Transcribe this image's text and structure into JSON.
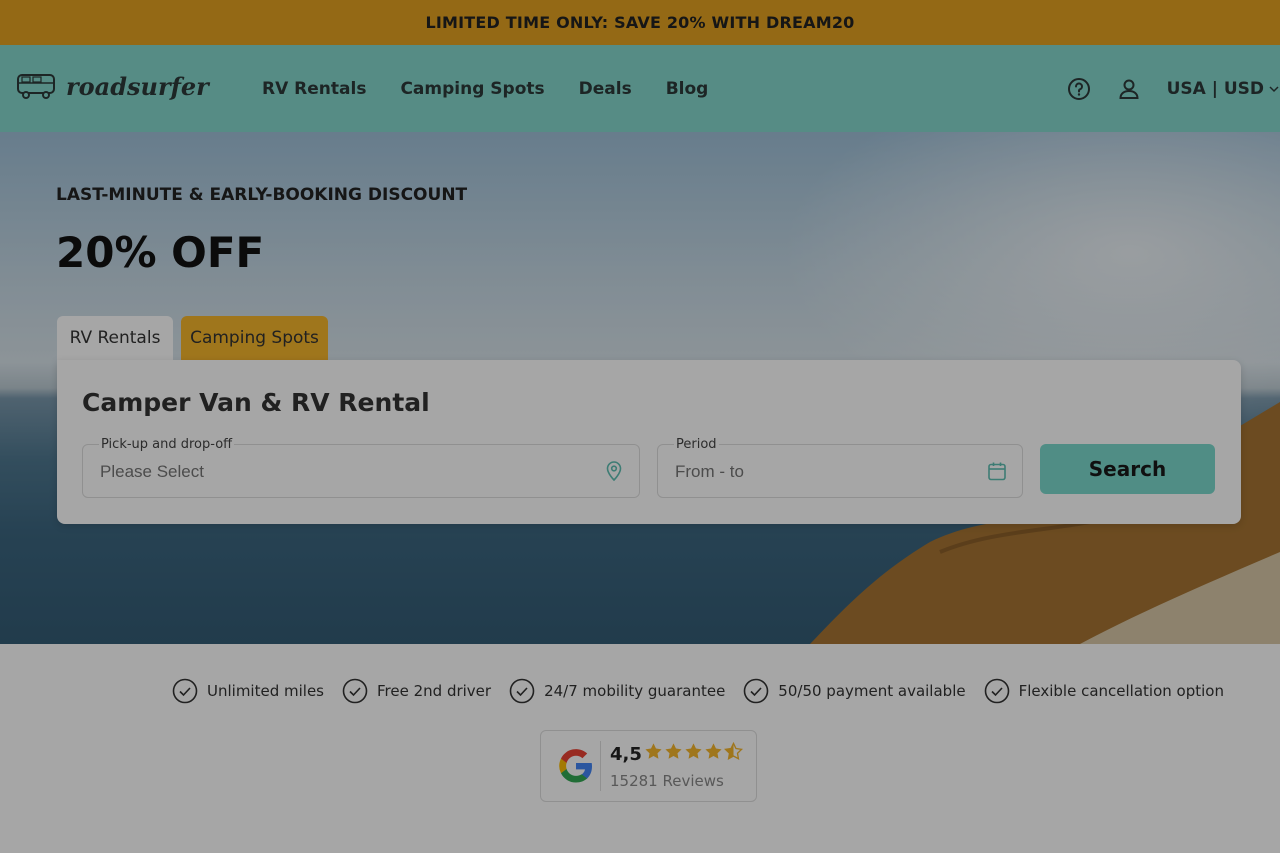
{
  "promo": {
    "text": "LIMITED TIME ONLY: SAVE 20% WITH DREAM20"
  },
  "header": {
    "logo_text": "roadsurfer",
    "nav": [
      "RV Rentals",
      "Camping Spots",
      "Deals",
      "Blog"
    ],
    "locale": "USA | USD",
    "icons": [
      "help-icon",
      "user-icon",
      "chevron-down-icon"
    ]
  },
  "hero": {
    "kicker": "LAST-MINUTE & EARLY-BOOKING DISCOUNT",
    "headline": "20% OFF",
    "tabs": [
      "RV Rentals",
      "Camping Spots"
    ],
    "active_tab": "RV Rentals"
  },
  "search": {
    "title": "Camper Van & RV Rental",
    "pickup": {
      "label": "Pick-up and drop-off",
      "placeholder": "Please Select",
      "icon": "location-pin-icon"
    },
    "period": {
      "label": "Period",
      "placeholder": "From - to",
      "icon": "calendar-icon"
    },
    "button": "Search"
  },
  "usps": [
    "Unlimited miles",
    "Free 2nd driver",
    "24/7 mobility guarantee",
    "50/50 payment available",
    "Flexible cancellation option"
  ],
  "reviews": {
    "rating": "4,5",
    "stars": 4.5,
    "count": "15281 Reviews",
    "icon": "google-icon"
  },
  "colors": {
    "promo": "#e3a221",
    "nav": "#84d8cc",
    "accent": "#7cd9cd",
    "tab_active": "#f5b52c",
    "star": "#f5b52c"
  }
}
